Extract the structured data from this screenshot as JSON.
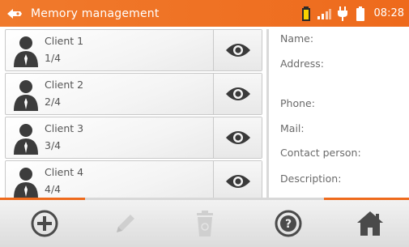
{
  "header": {
    "title": "Memory management",
    "time": "08:28",
    "icons": [
      "back-icon",
      "battery-status-icon",
      "signal-icon",
      "plug-icon",
      "battery-icon"
    ]
  },
  "clients": [
    {
      "name": "Client 1",
      "index": "1/4"
    },
    {
      "name": "Client 2",
      "index": "2/4"
    },
    {
      "name": "Client 3",
      "index": "3/4"
    },
    {
      "name": "Client 4",
      "index": "4/4"
    }
  ],
  "details": {
    "name_label": "Name:",
    "address_label": "Address:",
    "phone_label": "Phone:",
    "mail_label": "Mail:",
    "contact_label": "Contact person:",
    "description_label": "Description:"
  },
  "toolbar": {
    "buttons": [
      "add-icon",
      "edit-icon",
      "delete-icon",
      "help-icon",
      "home-icon"
    ]
  },
  "colors": {
    "accent": "#ee6a1c",
    "icon_dark": "#4a4a4a",
    "icon_disabled": "#c8c8c8"
  }
}
